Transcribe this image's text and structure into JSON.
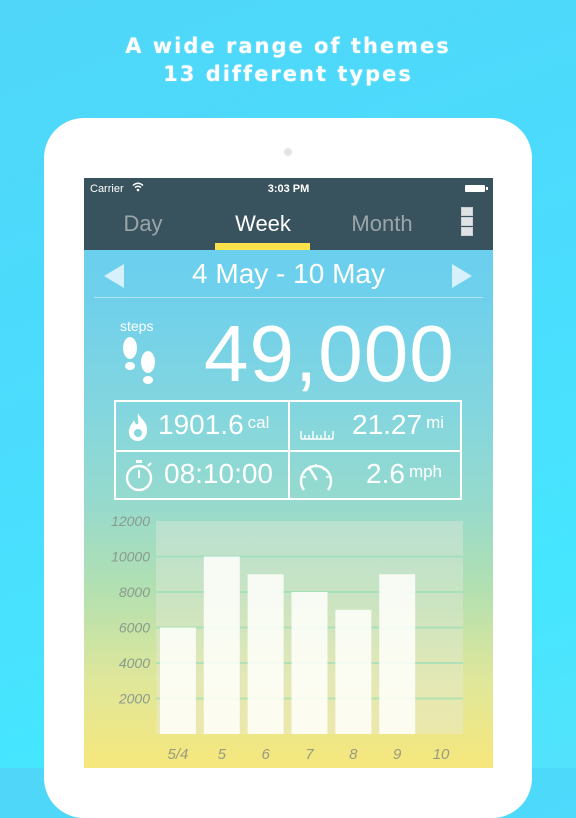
{
  "promo": {
    "line1": "A wide range of themes",
    "line2": "13 different types"
  },
  "status_bar": {
    "carrier": "Carrier",
    "time": "3:03 PM"
  },
  "tabs": [
    {
      "label": "Day",
      "selected": false
    },
    {
      "label": "Week",
      "selected": true
    },
    {
      "label": "Month",
      "selected": false
    }
  ],
  "date_range": "4 May - 10 May",
  "steps": {
    "label": "steps",
    "value": "49,000"
  },
  "stats": {
    "calories": {
      "value": "1901.6",
      "unit": "cal"
    },
    "distance": {
      "value": "21.27",
      "unit": "mi"
    },
    "duration": {
      "value": "08:10:00"
    },
    "speed": {
      "value": "2.6",
      "unit": "mph"
    }
  },
  "colors": {
    "nav_bg": "#39535e",
    "accent": "#fde24c"
  },
  "chart_data": {
    "type": "bar",
    "title": "",
    "xlabel": "",
    "ylabel": "",
    "categories": [
      "5/4",
      "5",
      "6",
      "7",
      "8",
      "9",
      "10"
    ],
    "values": [
      6000,
      10000,
      9000,
      8000,
      7000,
      9000,
      0
    ],
    "yticks": [
      2000,
      4000,
      6000,
      8000,
      10000,
      12000
    ],
    "ylim": [
      0,
      12000
    ],
    "grid": true
  }
}
